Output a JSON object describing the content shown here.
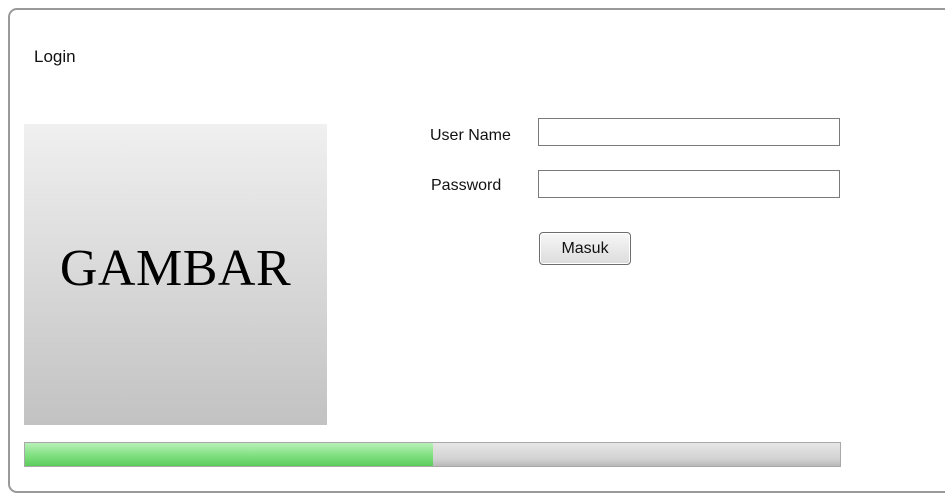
{
  "window": {
    "title": "Login"
  },
  "image": {
    "label": "GAMBAR"
  },
  "form": {
    "username_label": "User Name",
    "username_value": "",
    "password_label": "Password",
    "password_value": "",
    "submit_label": "Masuk"
  },
  "progress": {
    "value_percent": 50,
    "fill_color": "#6fd86f",
    "track_color": "#d5d5d5"
  }
}
